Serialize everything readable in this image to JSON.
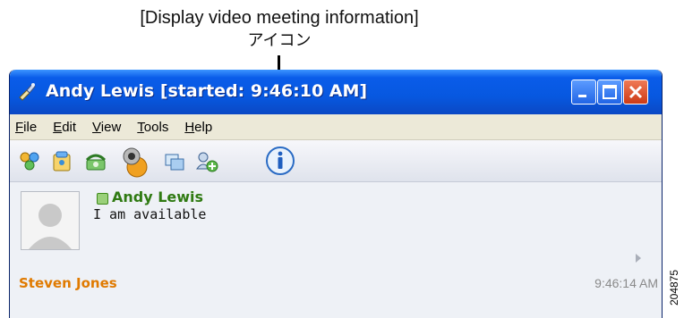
{
  "callout": {
    "line1": "[Display video meeting information]",
    "line2": "アイコン"
  },
  "window": {
    "title": "Andy Lewis [started: 9:46:10 AM]",
    "controls": [
      "minimize-icon",
      "maximize-icon",
      "close-icon"
    ]
  },
  "menu": [
    {
      "key": "F",
      "rest": "ile"
    },
    {
      "key": "E",
      "rest": "dit"
    },
    {
      "key": "V",
      "rest": "iew"
    },
    {
      "key": "T",
      "rest": "ools"
    },
    {
      "key": "H",
      "rest": "elp"
    }
  ],
  "toolbar": {
    "icons": [
      "contacts-icon",
      "phonebook-icon",
      "phone-icon",
      "webcam-icon",
      "screen-share-icon",
      "add-participant-icon",
      "info-icon"
    ]
  },
  "contact": {
    "name": "Andy Lewis",
    "status": "I am available",
    "status_color": "#3e8a1a"
  },
  "message": {
    "sender": "Steven Jones",
    "time": "9:46:14 AM",
    "sender_color": "#e07a00"
  },
  "figure_number": "204875"
}
